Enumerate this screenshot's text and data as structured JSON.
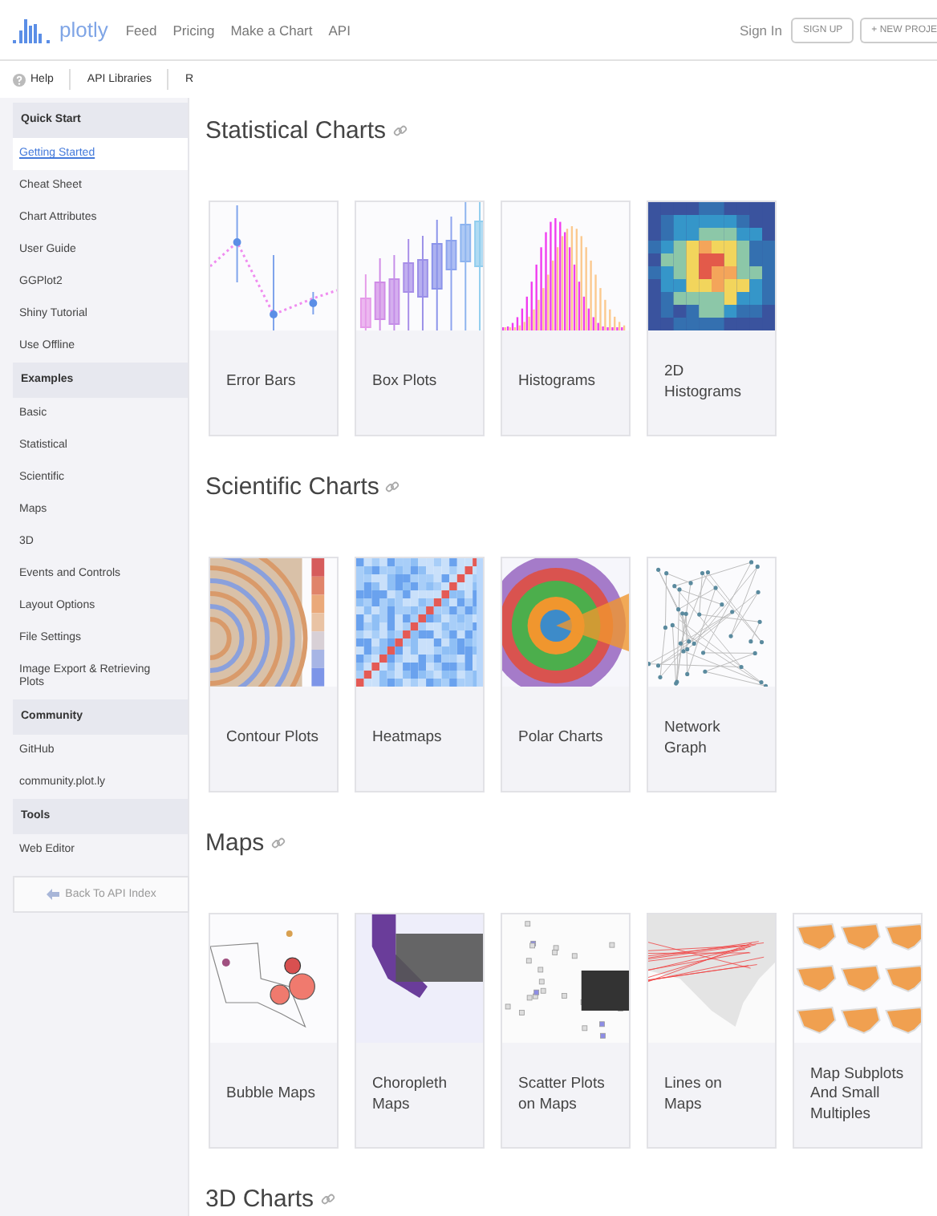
{
  "header": {
    "logo": "plotly",
    "nav": [
      "Feed",
      "Pricing",
      "Make a Chart",
      "API"
    ],
    "sign_in": "Sign In",
    "buttons": [
      "SIGN UP",
      "+ NEW PROJE"
    ]
  },
  "subnav": {
    "help": "Help",
    "items": [
      "API Libraries",
      "R"
    ]
  },
  "sidebar": {
    "groups": [
      {
        "title": "Quick Start",
        "items": [
          {
            "label": "Getting Started",
            "selected": true
          },
          {
            "label": "Cheat Sheet",
            "selected": false
          },
          {
            "label": "Chart Attributes",
            "selected": false
          },
          {
            "label": "User Guide",
            "selected": false
          },
          {
            "label": "GGPlot2",
            "selected": false
          },
          {
            "label": "Shiny Tutorial",
            "selected": false
          },
          {
            "label": "Use Offline",
            "selected": false
          }
        ]
      },
      {
        "title": "Examples",
        "items": [
          {
            "label": "Basic",
            "selected": false
          },
          {
            "label": "Statistical",
            "selected": false
          },
          {
            "label": "Scientific",
            "selected": false
          },
          {
            "label": "Maps",
            "selected": false
          },
          {
            "label": "3D",
            "selected": false
          },
          {
            "label": "Events and Controls",
            "selected": false
          },
          {
            "label": "Layout Options",
            "selected": false
          },
          {
            "label": "File Settings",
            "selected": false
          },
          {
            "label": "Image Export & Retrieving Plots",
            "selected": false
          }
        ]
      },
      {
        "title": "Community",
        "items": [
          {
            "label": "GitHub",
            "selected": false
          },
          {
            "label": "community.plot.ly",
            "selected": false
          }
        ]
      },
      {
        "title": "Tools",
        "items": [
          {
            "label": "Web Editor",
            "selected": false
          }
        ]
      }
    ],
    "back_button": "Back To API Index"
  },
  "sections": [
    {
      "title": "Statistical Charts",
      "cards": [
        {
          "label": "Error Bars",
          "kind": "errorbars"
        },
        {
          "label": "Box Plots",
          "kind": "box"
        },
        {
          "label": "Histograms",
          "kind": "histogram"
        },
        {
          "label": "2D Histograms",
          "kind": "hist2d"
        }
      ]
    },
    {
      "title": "Scientific Charts",
      "cards": [
        {
          "label": "Contour Plots",
          "kind": "contour"
        },
        {
          "label": "Heatmaps",
          "kind": "heatmap"
        },
        {
          "label": "Polar Charts",
          "kind": "polar"
        },
        {
          "label": "Network Graph",
          "kind": "network"
        }
      ]
    },
    {
      "title": "Maps",
      "cards": [
        {
          "label": "Bubble Maps",
          "kind": "bubble"
        },
        {
          "label": "Choropleth Maps",
          "kind": "choropleth"
        },
        {
          "label": "Scatter Plots on Maps",
          "kind": "scattermap"
        },
        {
          "label": "Lines on Maps",
          "kind": "linesmap"
        },
        {
          "label": "Map Subplots And Small Multiples",
          "kind": "subplots"
        }
      ]
    },
    {
      "title": "3D Charts"
    }
  ]
}
